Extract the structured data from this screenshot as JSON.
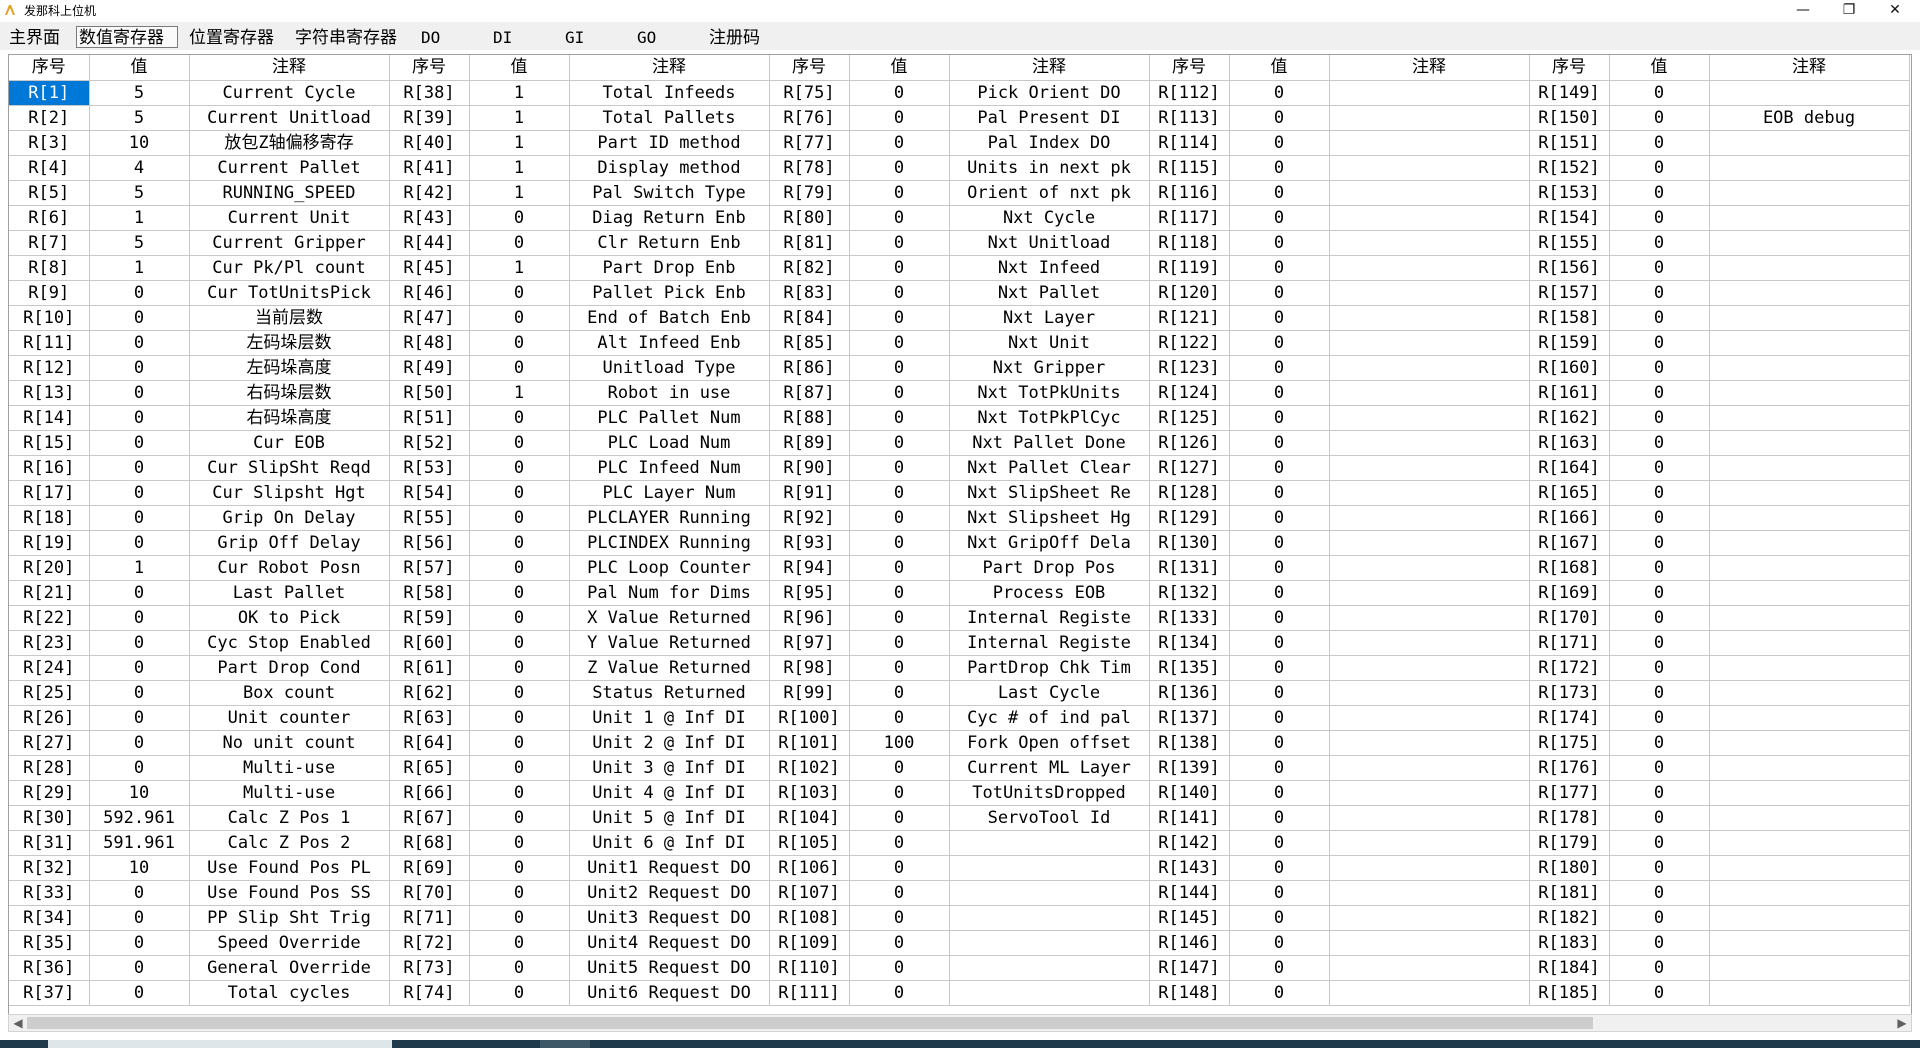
{
  "window": {
    "title": "发那科上位机",
    "icon": "fanuc-app-icon"
  },
  "tabs": [
    {
      "label": "主界面",
      "active": false
    },
    {
      "label": "数值寄存器",
      "active": true
    },
    {
      "label": "位置寄存器",
      "active": false
    },
    {
      "label": "字符串寄存器",
      "active": false
    },
    {
      "label": "DO",
      "active": false
    },
    {
      "label": "DI",
      "active": false
    },
    {
      "label": "GI",
      "active": false
    },
    {
      "label": "GO",
      "active": false
    },
    {
      "label": "注册码",
      "active": false
    }
  ],
  "grid": {
    "headers": [
      "序号",
      "值",
      "注释",
      "序号",
      "值",
      "注释",
      "序号",
      "值",
      "注释",
      "序号",
      "值",
      "注释",
      "序号",
      "值",
      "注释"
    ],
    "selected_cell": "R[1]",
    "rows": [
      [
        "R[1]",
        "5",
        "Current Cycle",
        "R[38]",
        "1",
        "Total Infeeds",
        "R[75]",
        "0",
        "Pick Orient DO",
        "R[112]",
        "0",
        "",
        "R[149]",
        "0",
        ""
      ],
      [
        "R[2]",
        "5",
        "Current Unitload",
        "R[39]",
        "1",
        "Total Pallets",
        "R[76]",
        "0",
        "Pal Present DI",
        "R[113]",
        "0",
        "",
        "R[150]",
        "0",
        "EOB debug"
      ],
      [
        "R[3]",
        "10",
        "放包Z轴偏移寄存",
        "R[40]",
        "1",
        "Part ID method",
        "R[77]",
        "0",
        "Pal Index DO",
        "R[114]",
        "0",
        "",
        "R[151]",
        "0",
        ""
      ],
      [
        "R[4]",
        "4",
        "Current Pallet",
        "R[41]",
        "1",
        "Display method",
        "R[78]",
        "0",
        "Units in next pk",
        "R[115]",
        "0",
        "",
        "R[152]",
        "0",
        ""
      ],
      [
        "R[5]",
        "5",
        "RUNNING_SPEED",
        "R[42]",
        "1",
        "Pal Switch Type",
        "R[79]",
        "0",
        "Orient of nxt pk",
        "R[116]",
        "0",
        "",
        "R[153]",
        "0",
        ""
      ],
      [
        "R[6]",
        "1",
        "Current Unit",
        "R[43]",
        "0",
        "Diag Return Enb",
        "R[80]",
        "0",
        "Nxt Cycle",
        "R[117]",
        "0",
        "",
        "R[154]",
        "0",
        ""
      ],
      [
        "R[7]",
        "5",
        "Current Gripper",
        "R[44]",
        "0",
        "Clr Return Enb",
        "R[81]",
        "0",
        "Nxt Unitload",
        "R[118]",
        "0",
        "",
        "R[155]",
        "0",
        ""
      ],
      [
        "R[8]",
        "1",
        "Cur Pk/Pl count",
        "R[45]",
        "1",
        "Part Drop Enb",
        "R[82]",
        "0",
        "Nxt Infeed",
        "R[119]",
        "0",
        "",
        "R[156]",
        "0",
        ""
      ],
      [
        "R[9]",
        "0",
        "Cur TotUnitsPick",
        "R[46]",
        "0",
        "Pallet Pick Enb",
        "R[83]",
        "0",
        "Nxt Pallet",
        "R[120]",
        "0",
        "",
        "R[157]",
        "0",
        ""
      ],
      [
        "R[10]",
        "0",
        "当前层数",
        "R[47]",
        "0",
        "End of Batch Enb",
        "R[84]",
        "0",
        "Nxt Layer",
        "R[121]",
        "0",
        "",
        "R[158]",
        "0",
        ""
      ],
      [
        "R[11]",
        "0",
        "左码垛层数",
        "R[48]",
        "0",
        "Alt Infeed Enb",
        "R[85]",
        "0",
        "Nxt Unit",
        "R[122]",
        "0",
        "",
        "R[159]",
        "0",
        ""
      ],
      [
        "R[12]",
        "0",
        "左码垛高度",
        "R[49]",
        "0",
        "Unitload Type",
        "R[86]",
        "0",
        "Nxt Gripper",
        "R[123]",
        "0",
        "",
        "R[160]",
        "0",
        ""
      ],
      [
        "R[13]",
        "0",
        "右码垛层数",
        "R[50]",
        "1",
        "Robot in use",
        "R[87]",
        "0",
        "Nxt TotPkUnits",
        "R[124]",
        "0",
        "",
        "R[161]",
        "0",
        ""
      ],
      [
        "R[14]",
        "0",
        "右码垛高度",
        "R[51]",
        "0",
        "PLC Pallet Num",
        "R[88]",
        "0",
        "Nxt TotPkPlCyc",
        "R[125]",
        "0",
        "",
        "R[162]",
        "0",
        ""
      ],
      [
        "R[15]",
        "0",
        "Cur EOB",
        "R[52]",
        "0",
        "PLC Load Num",
        "R[89]",
        "0",
        "Nxt Pallet Done",
        "R[126]",
        "0",
        "",
        "R[163]",
        "0",
        ""
      ],
      [
        "R[16]",
        "0",
        "Cur SlipSht Reqd",
        "R[53]",
        "0",
        "PLC Infeed Num",
        "R[90]",
        "0",
        "Nxt Pallet Clear",
        "R[127]",
        "0",
        "",
        "R[164]",
        "0",
        ""
      ],
      [
        "R[17]",
        "0",
        "Cur Slipsht Hgt",
        "R[54]",
        "0",
        "PLC Layer Num",
        "R[91]",
        "0",
        "Nxt SlipSheet Re",
        "R[128]",
        "0",
        "",
        "R[165]",
        "0",
        ""
      ],
      [
        "R[18]",
        "0",
        "Grip On Delay",
        "R[55]",
        "0",
        "PLCLAYER Running",
        "R[92]",
        "0",
        "Nxt Slipsheet Hg",
        "R[129]",
        "0",
        "",
        "R[166]",
        "0",
        ""
      ],
      [
        "R[19]",
        "0",
        "Grip Off Delay",
        "R[56]",
        "0",
        "PLCINDEX Running",
        "R[93]",
        "0",
        "Nxt GripOff Dela",
        "R[130]",
        "0",
        "",
        "R[167]",
        "0",
        ""
      ],
      [
        "R[20]",
        "1",
        "Cur Robot Posn",
        "R[57]",
        "0",
        "PLC Loop Counter",
        "R[94]",
        "0",
        "Part Drop Pos",
        "R[131]",
        "0",
        "",
        "R[168]",
        "0",
        ""
      ],
      [
        "R[21]",
        "0",
        "Last Pallet",
        "R[58]",
        "0",
        "Pal Num for Dims",
        "R[95]",
        "0",
        "Process EOB",
        "R[132]",
        "0",
        "",
        "R[169]",
        "0",
        ""
      ],
      [
        "R[22]",
        "0",
        "OK to Pick",
        "R[59]",
        "0",
        "X Value Returned",
        "R[96]",
        "0",
        "Internal Registe",
        "R[133]",
        "0",
        "",
        "R[170]",
        "0",
        ""
      ],
      [
        "R[23]",
        "0",
        "Cyc Stop Enabled",
        "R[60]",
        "0",
        "Y Value Returned",
        "R[97]",
        "0",
        "Internal Registe",
        "R[134]",
        "0",
        "",
        "R[171]",
        "0",
        ""
      ],
      [
        "R[24]",
        "0",
        "Part Drop Cond",
        "R[61]",
        "0",
        "Z Value Returned",
        "R[98]",
        "0",
        "PartDrop Chk Tim",
        "R[135]",
        "0",
        "",
        "R[172]",
        "0",
        ""
      ],
      [
        "R[25]",
        "0",
        "Box count",
        "R[62]",
        "0",
        "Status Returned",
        "R[99]",
        "0",
        "Last Cycle",
        "R[136]",
        "0",
        "",
        "R[173]",
        "0",
        ""
      ],
      [
        "R[26]",
        "0",
        "Unit counter",
        "R[63]",
        "0",
        "Unit 1 @ Inf DI",
        "R[100]",
        "0",
        "Cyc # of ind pal",
        "R[137]",
        "0",
        "",
        "R[174]",
        "0",
        ""
      ],
      [
        "R[27]",
        "0",
        "No unit count",
        "R[64]",
        "0",
        "Unit 2 @ Inf DI",
        "R[101]",
        "100",
        "Fork Open offset",
        "R[138]",
        "0",
        "",
        "R[175]",
        "0",
        ""
      ],
      [
        "R[28]",
        "0",
        "Multi-use",
        "R[65]",
        "0",
        "Unit 3 @ Inf DI",
        "R[102]",
        "0",
        "Current ML Layer",
        "R[139]",
        "0",
        "",
        "R[176]",
        "0",
        ""
      ],
      [
        "R[29]",
        "10",
        "Multi-use",
        "R[66]",
        "0",
        "Unit 4 @ Inf DI",
        "R[103]",
        "0",
        "TotUnitsDropped",
        "R[140]",
        "0",
        "",
        "R[177]",
        "0",
        ""
      ],
      [
        "R[30]",
        "592.961",
        "Calc Z Pos 1",
        "R[67]",
        "0",
        "Unit 5 @ Inf DI",
        "R[104]",
        "0",
        "ServoTool Id",
        "R[141]",
        "0",
        "",
        "R[178]",
        "0",
        ""
      ],
      [
        "R[31]",
        "591.961",
        "Calc Z Pos 2",
        "R[68]",
        "0",
        "Unit 6 @ Inf DI",
        "R[105]",
        "0",
        "",
        "R[142]",
        "0",
        "",
        "R[179]",
        "0",
        ""
      ],
      [
        "R[32]",
        "10",
        "Use Found Pos PL",
        "R[69]",
        "0",
        "Unit1 Request DO",
        "R[106]",
        "0",
        "",
        "R[143]",
        "0",
        "",
        "R[180]",
        "0",
        ""
      ],
      [
        "R[33]",
        "0",
        "Use Found Pos SS",
        "R[70]",
        "0",
        "Unit2 Request DO",
        "R[107]",
        "0",
        "",
        "R[144]",
        "0",
        "",
        "R[181]",
        "0",
        ""
      ],
      [
        "R[34]",
        "0",
        "PP Slip Sht Trig",
        "R[71]",
        "0",
        "Unit3 Request DO",
        "R[108]",
        "0",
        "",
        "R[145]",
        "0",
        "",
        "R[182]",
        "0",
        ""
      ],
      [
        "R[35]",
        "0",
        "Speed Override",
        "R[72]",
        "0",
        "Unit4 Request DO",
        "R[109]",
        "0",
        "",
        "R[146]",
        "0",
        "",
        "R[183]",
        "0",
        ""
      ],
      [
        "R[36]",
        "0",
        "General Override",
        "R[73]",
        "0",
        "Unit5 Request DO",
        "R[110]",
        "0",
        "",
        "R[147]",
        "0",
        "",
        "R[184]",
        "0",
        ""
      ],
      [
        "R[37]",
        "0",
        "Total cycles",
        "R[74]",
        "0",
        "Unit6 Request DO",
        "R[111]",
        "0",
        "",
        "R[148]",
        "0",
        "",
        "R[185]",
        "0",
        ""
      ]
    ]
  },
  "colors": {
    "selection": "#0078d7",
    "grid_line": "#c8c8c8",
    "tabbar_bg": "#f0f0f0"
  }
}
